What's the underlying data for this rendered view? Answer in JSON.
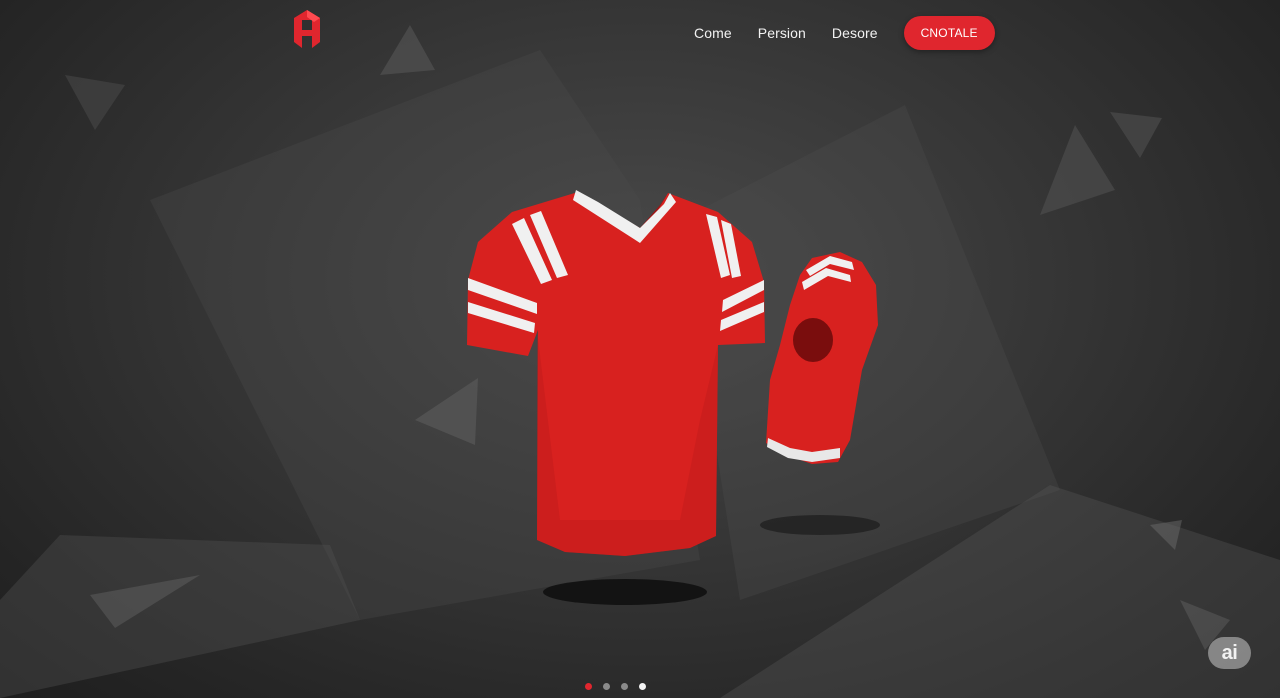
{
  "brand": {
    "logo_icon": "red-geometric-logo-icon",
    "accent_color": "#e0262e"
  },
  "nav": {
    "links": [
      "Come",
      "Persion",
      "Desore"
    ],
    "cta_label": "CNOTALE"
  },
  "hero": {
    "product_icon": "red-football-jersey-icon",
    "secondary_icon": "red-jersey-sleeve-icon",
    "jersey_color": "#d8211f",
    "stripe_color": "#f0f0f0"
  },
  "carousel": {
    "slide_count": 4,
    "active_index": 0
  },
  "watermark": {
    "label": "ai"
  }
}
